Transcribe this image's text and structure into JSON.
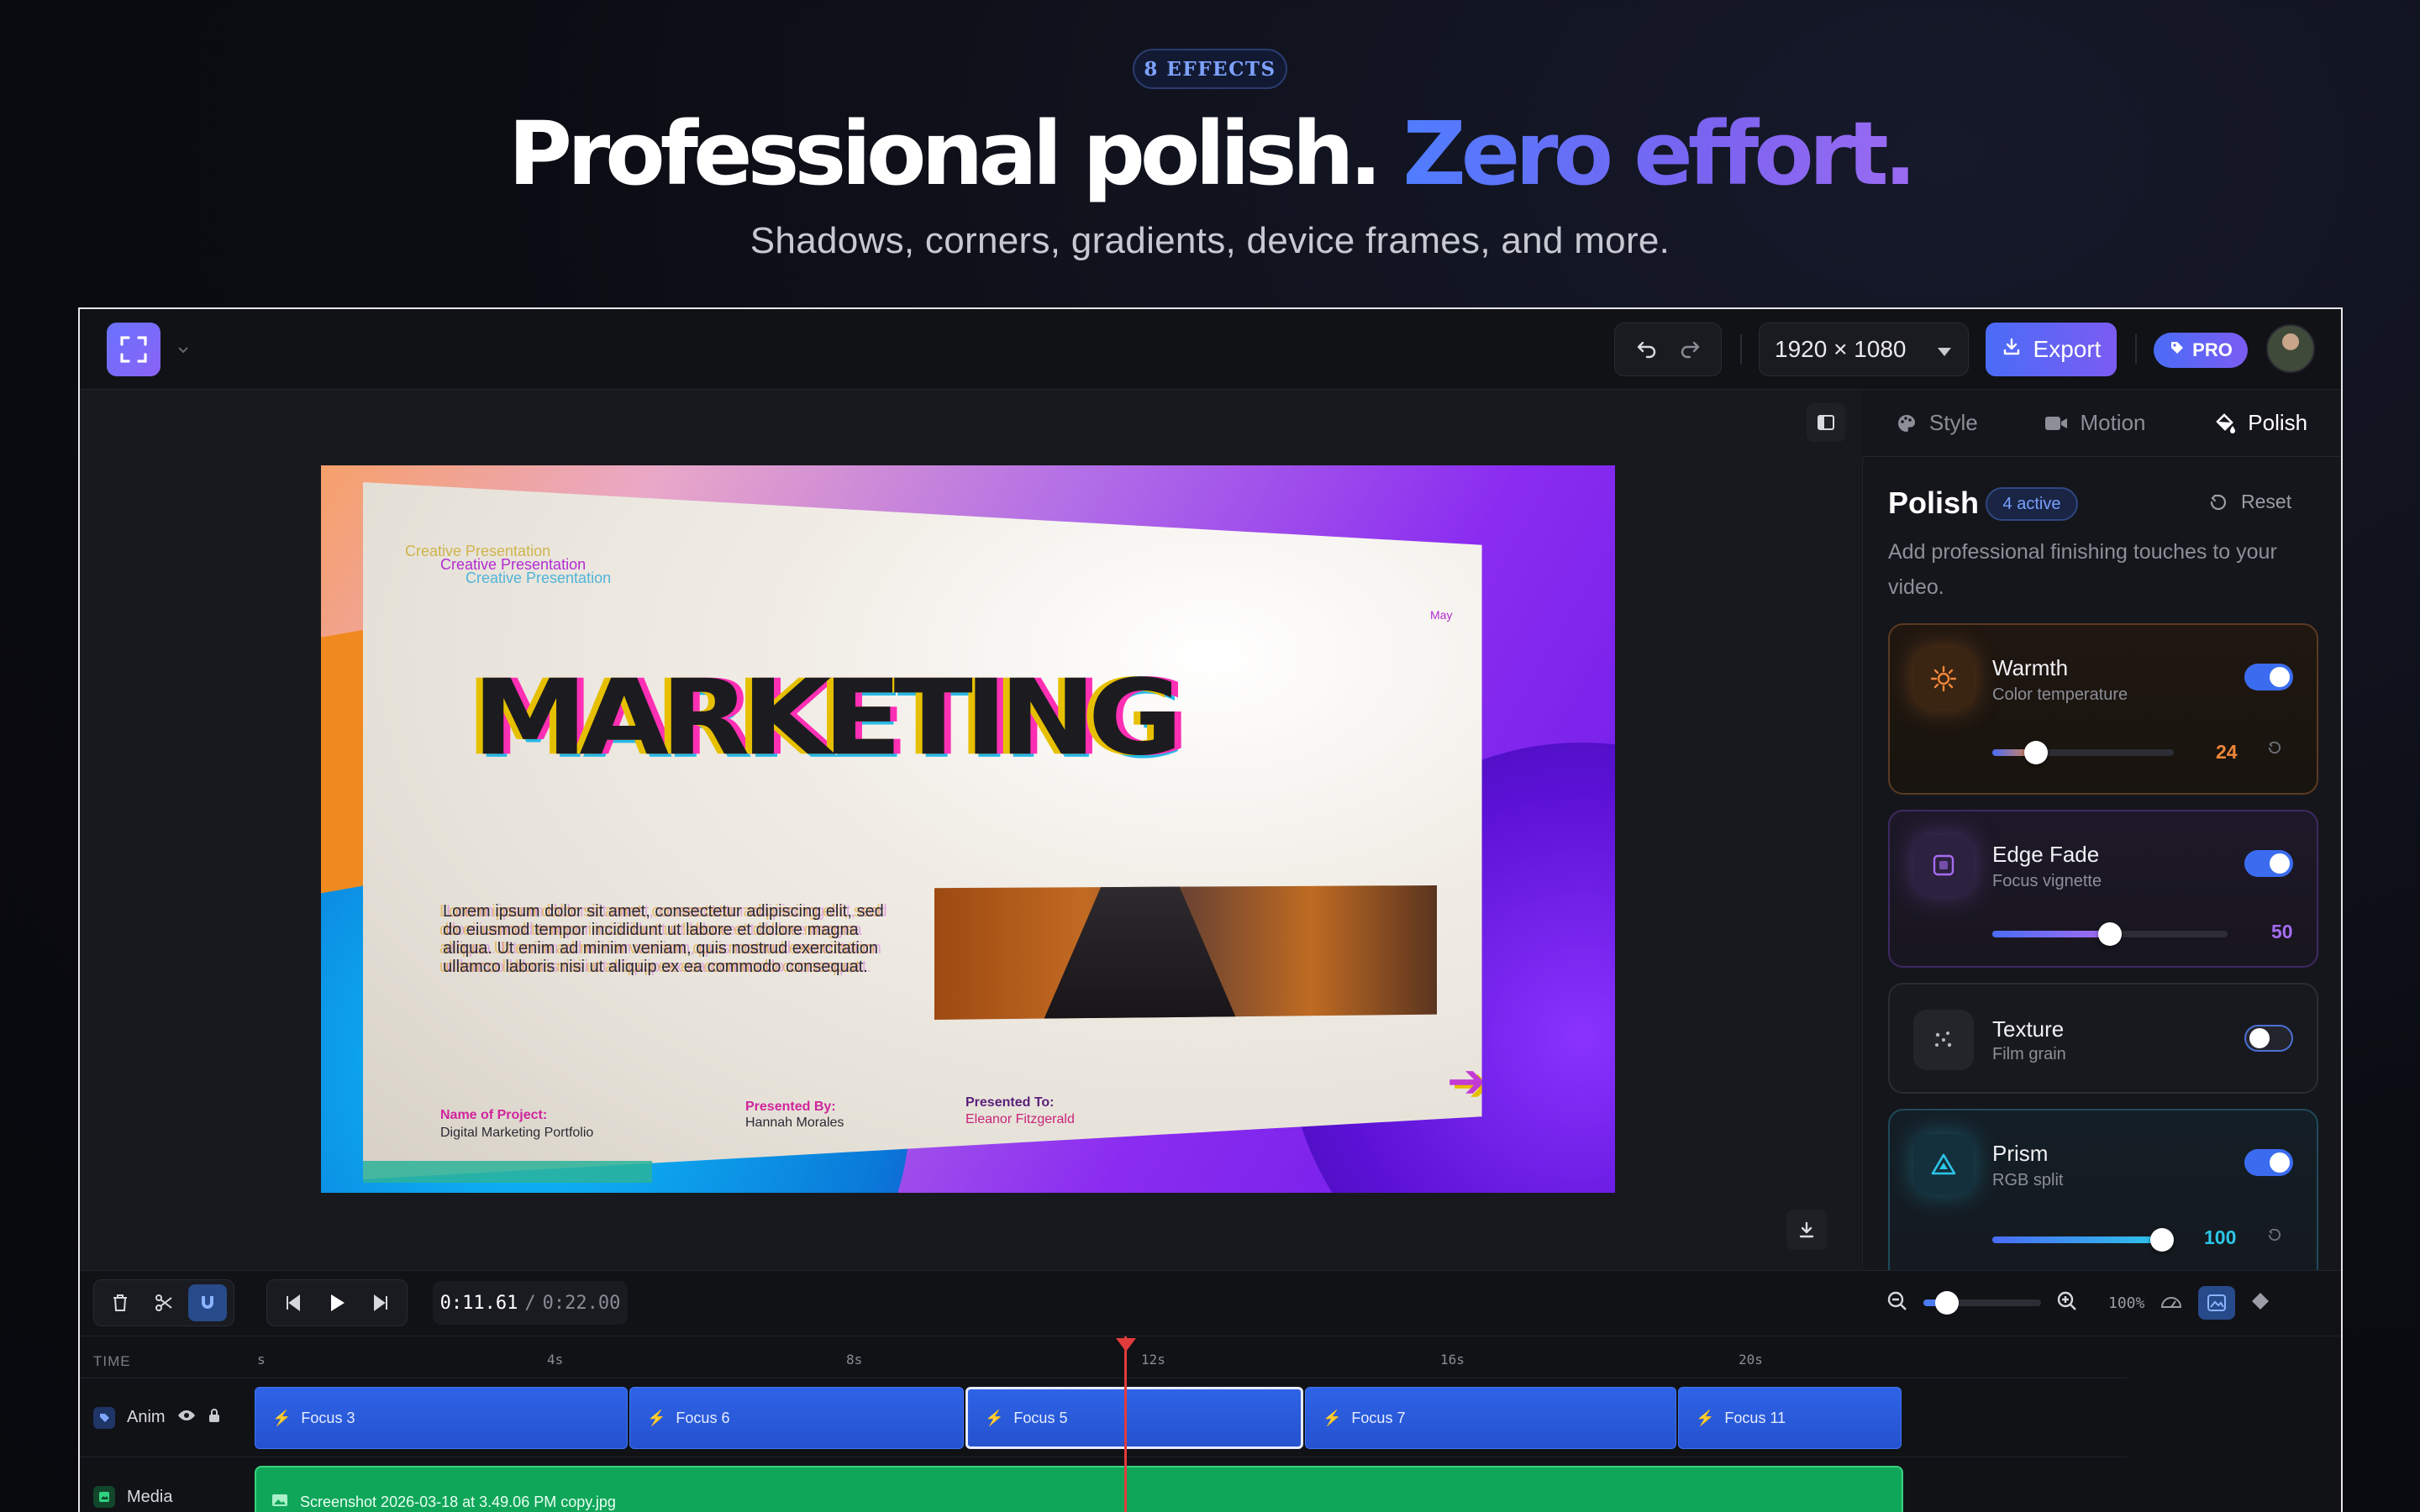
{
  "hero": {
    "badge": "8 EFFECTS",
    "title_main": "Professional polish.",
    "title_accent": "Zero effort.",
    "subtitle": "Shadows, corners, gradients, device frames, and more."
  },
  "toolbar": {
    "resolution": "1920 × 1080",
    "export_label": "Export",
    "pro_label": "PRO"
  },
  "slide": {
    "small_title": "Creative Presentation",
    "month": "May",
    "headline": "MARKETING",
    "body": "Lorem ipsum dolor sit amet, consectetur adipiscing elit, sed do eiusmod tempor incididunt ut labore et dolore magna aliqua. Ut enim ad minim veniam, quis nostrud exercitation ullamco laboris nisi ut aliquip ex ea commodo consequat.",
    "project_label": "Name of Project:",
    "project_value": "Digital Marketing Portfolio",
    "presented_by_label": "Presented By:",
    "presented_by_value": "Hannah Morales",
    "presented_to_label": "Presented To:",
    "presented_to_value": "Eleanor Fitzgerald"
  },
  "panel": {
    "tabs": [
      {
        "label": "Style",
        "icon": "palette-icon"
      },
      {
        "label": "Motion",
        "icon": "video-camera-icon"
      },
      {
        "label": "Polish",
        "icon": "paint-bucket-icon"
      }
    ],
    "active_tab": "Polish",
    "title": "Polish",
    "active_badge": "4 active",
    "reset_label": "Reset",
    "description": "Add professional finishing touches to your video.",
    "effects": [
      {
        "name": "Warmth",
        "note": "Color temperature",
        "enabled": true,
        "value": 24,
        "max": 100,
        "color": "#f0873a",
        "icon": "sun-icon"
      },
      {
        "name": "Edge Fade",
        "note": "Focus vignette",
        "enabled": true,
        "value": 50,
        "max": 100,
        "color": "#a56cf0",
        "icon": "vignette-icon"
      },
      {
        "name": "Texture",
        "note": "Film grain",
        "enabled": false,
        "icon": "grain-icon"
      },
      {
        "name": "Prism",
        "note": "RGB split",
        "enabled": true,
        "value": 100,
        "max": 100,
        "color": "#2cc6e8",
        "icon": "triangle-prism-icon"
      }
    ]
  },
  "timeline": {
    "current_time": "0:11.61",
    "separator": "/",
    "total_time": "0:22.00",
    "zoom_pct": "100%",
    "zoom_level": 0.2,
    "ruler_header": "TIME",
    "ruler_labels": [
      "s",
      "4s",
      "8s",
      "12s",
      "16s",
      "20s"
    ],
    "playhead_seconds": 11.61,
    "tracks": {
      "anim": {
        "label": "Anim",
        "clips": [
          "Focus 3",
          "Focus 6",
          "Focus 5",
          "Focus 7",
          "Focus 11"
        ],
        "selected_clip": "Focus 5"
      },
      "media": {
        "label": "Media",
        "clip": "Screenshot 2026-03-18 at 3.49.06 PM copy.jpg"
      }
    }
  },
  "colors": {
    "accent": "#4a6cf7",
    "accent_2": "#7b5cf2",
    "media_clip": "#10a65a",
    "playhead": "#e23b3b"
  }
}
